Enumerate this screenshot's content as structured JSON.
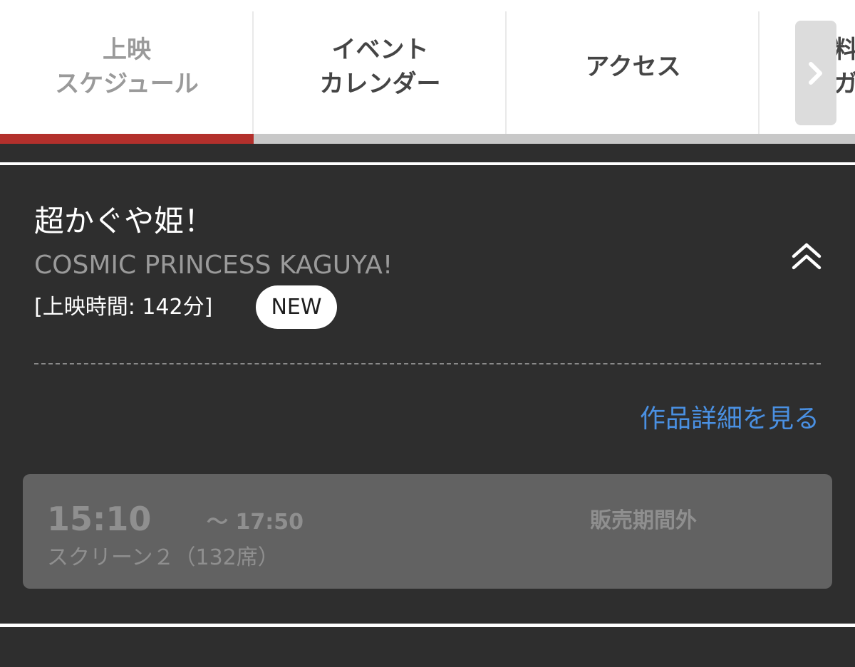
{
  "tabs": [
    {
      "label": "上映\nスケジュール",
      "active": true
    },
    {
      "label": "イベント\nカレンダー",
      "active": false
    },
    {
      "label": "アクセス",
      "active": false
    },
    {
      "label": "料金\nガー",
      "active": false
    }
  ],
  "tab_scroll_icon": "chevron-right-icon",
  "movie": {
    "title": "超かぐや姫！",
    "subtitle": "COSMIC PRINCESS KAGUYA!",
    "runtime": "[上映時間: 142分]",
    "badge": "NEW",
    "collapse_icon": "double-chevron-up-icon",
    "detail_link": "作品詳細を見る"
  },
  "showtime": {
    "start": "15:10",
    "end": "～ 17:50",
    "screen": "スクリーン２（132席）",
    "status": "販売期間外"
  },
  "colors": {
    "active_tab_underline": "#b3302c",
    "link": "#4a90e2",
    "panel_background": "#2e2e2e",
    "card_background": "#626262"
  }
}
